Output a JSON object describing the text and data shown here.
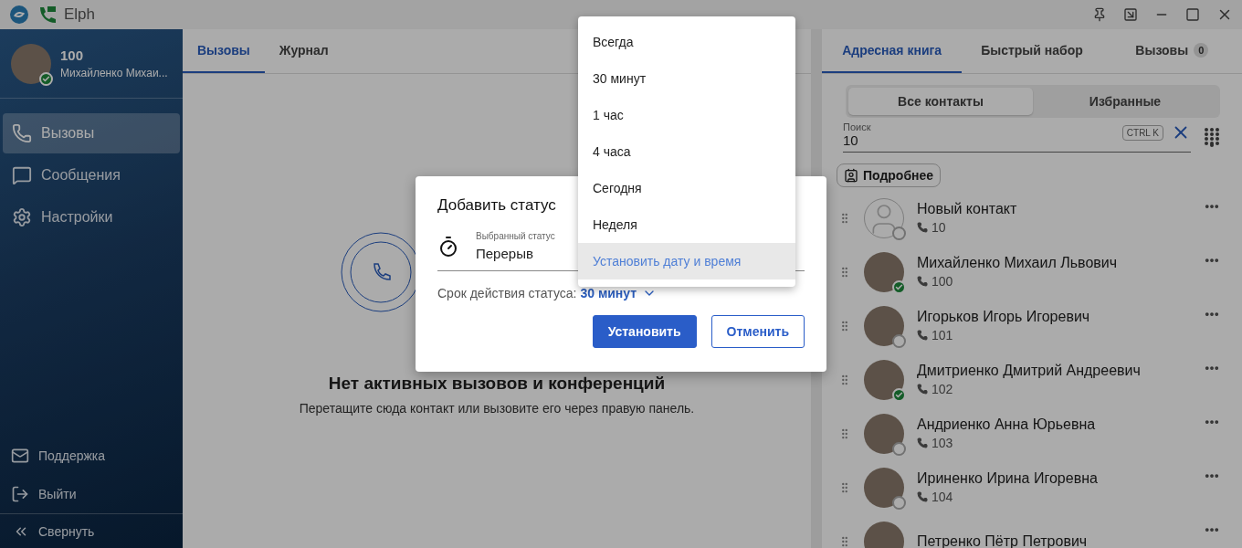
{
  "window": {
    "title": "Elph"
  },
  "sidebar": {
    "user": {
      "number": "100",
      "name": "Михайленко Михаи...",
      "online": true
    },
    "nav": [
      {
        "label": "Вызовы",
        "selected": true,
        "kind": "calls"
      },
      {
        "label": "Сообщения",
        "selected": false,
        "kind": "messages"
      },
      {
        "label": "Настройки",
        "selected": false,
        "kind": "settings"
      }
    ],
    "bottom": [
      {
        "label": "Поддержка",
        "kind": "support"
      },
      {
        "label": "Выйти",
        "kind": "logout"
      }
    ],
    "collapse": "Свернуть"
  },
  "center": {
    "tabs": [
      {
        "label": "Вызовы",
        "selected": true
      },
      {
        "label": "Журнал",
        "selected": false
      }
    ],
    "empty_title": "Нет активных вызовов и конференций",
    "empty_text": "Перетащите сюда контакт или вызовите его через правую панель."
  },
  "dialog": {
    "title": "Добавить статус",
    "field_label": "Выбранный статус",
    "field_value": "Перерыв",
    "expiry_label": "Срок действия статуса:",
    "expiry_value": "30 минут",
    "buttons": [
      {
        "label": "Установить",
        "kind": "primary"
      },
      {
        "label": "Отменить",
        "kind": "secondary"
      }
    ]
  },
  "dropdown": [
    {
      "label": "Всегда",
      "selected": false
    },
    {
      "label": "30 минут",
      "selected": false
    },
    {
      "label": "1 час",
      "selected": false
    },
    {
      "label": "4 часа",
      "selected": false
    },
    {
      "label": "Сегодня",
      "selected": false
    },
    {
      "label": "Неделя",
      "selected": false
    },
    {
      "label": "Установить дату и время",
      "selected": true
    }
  ],
  "right": {
    "tabs": [
      {
        "label": "Адресная книга",
        "selected": true
      },
      {
        "label": "Быстрый набор",
        "selected": false
      },
      {
        "label": "Вызовы",
        "selected": false,
        "badge": "0"
      }
    ],
    "segments": [
      {
        "label": "Все контакты",
        "selected": true
      },
      {
        "label": "Избранные",
        "selected": false
      }
    ],
    "search": {
      "label": "Поиск",
      "value": "10",
      "shortcut": "CTRL K"
    },
    "details_button": "Подробнее",
    "contacts": [
      {
        "name": "Новый контакт",
        "number": "10",
        "online": false,
        "kind": "new"
      },
      {
        "name": "Михайленко Михаил Львович",
        "number": "100",
        "online": true,
        "kind": "person"
      },
      {
        "name": "Игорьков Игорь Игоревич",
        "number": "101",
        "online": false,
        "kind": "person"
      },
      {
        "name": "Дмитриенко Дмитрий Андреевич",
        "number": "102",
        "online": true,
        "kind": "person"
      },
      {
        "name": "Андриенко Анна Юрьевна",
        "number": "103",
        "online": false,
        "kind": "person"
      },
      {
        "name": "Ириненко Ирина Игоревна",
        "number": "104",
        "online": false,
        "kind": "person"
      },
      {
        "name": "Петренко Пётр Петрович",
        "kind": "person"
      }
    ]
  }
}
